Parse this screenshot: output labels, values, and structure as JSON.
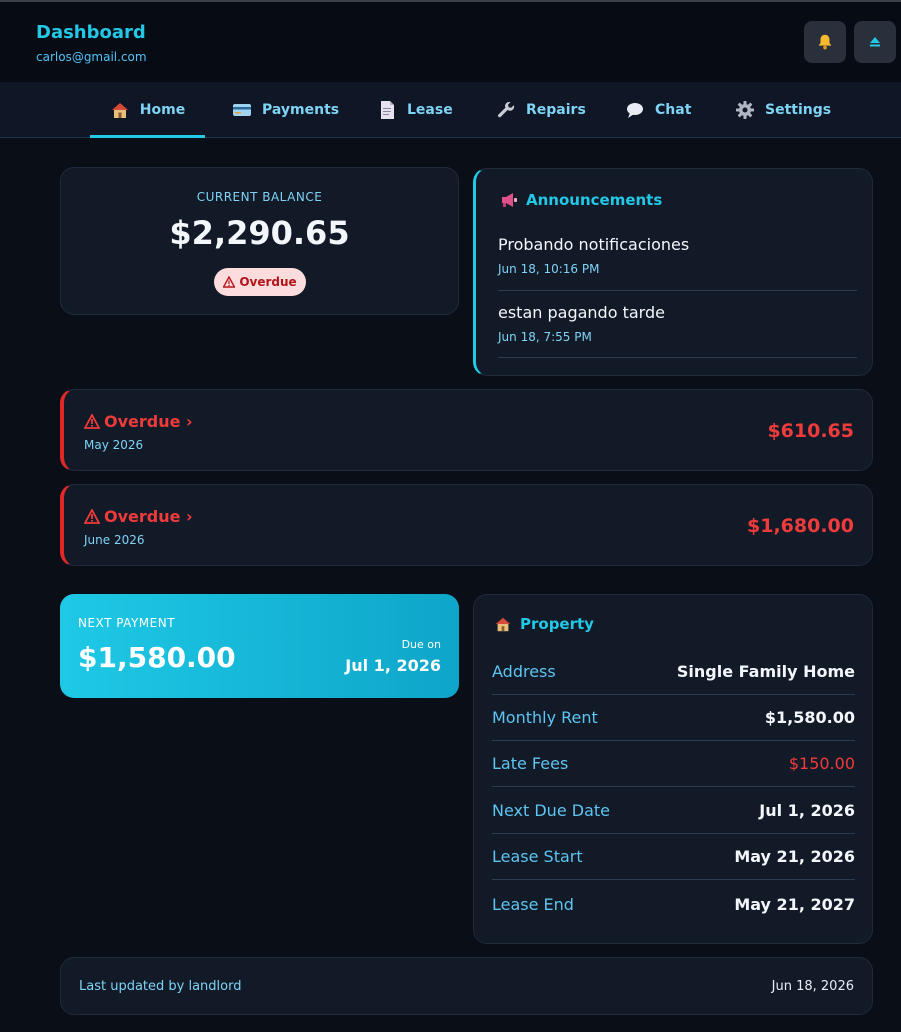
{
  "header": {
    "title": "Dashboard",
    "email": "carlos@gmail.com"
  },
  "nav": {
    "tabs": [
      {
        "label": "Home",
        "icon": "house-icon",
        "active": true
      },
      {
        "label": "Payments",
        "icon": "credit-card-icon"
      },
      {
        "label": "Lease",
        "icon": "document-icon"
      },
      {
        "label": "Repairs",
        "icon": "wrench-icon"
      },
      {
        "label": "Chat",
        "icon": "speech-bubble-icon"
      },
      {
        "label": "Settings",
        "icon": "gear-icon"
      }
    ]
  },
  "balance": {
    "label": "CURRENT BALANCE",
    "value": "$2,290.65",
    "status": "Overdue"
  },
  "announcements": {
    "title": "Announcements",
    "items": [
      {
        "text": "Probando notificaciones",
        "time": "Jun 18, 10:16 PM"
      },
      {
        "text": "estan pagando tarde",
        "time": "Jun 18, 7:55 PM"
      }
    ]
  },
  "overdue": [
    {
      "title": "Overdue ›",
      "month": "May 2026",
      "amount": "$610.65"
    },
    {
      "title": "Overdue ›",
      "month": "June 2026",
      "amount": "$1,680.00"
    }
  ],
  "next_payment": {
    "label": "NEXT PAYMENT",
    "amount": "$1,580.00",
    "due_label": "Due on",
    "due_date": "Jul 1, 2026"
  },
  "property": {
    "title": "Property",
    "rows": [
      {
        "key": "Address",
        "value": "Single Family Home"
      },
      {
        "key": "Monthly Rent",
        "value": "$1,580.00"
      },
      {
        "key": "Late Fees",
        "value": "$150.00"
      },
      {
        "key": "Next Due Date",
        "value": "Jul 1, 2026"
      },
      {
        "key": "Lease Start",
        "value": "May 21, 2026"
      },
      {
        "key": "Lease End",
        "value": "May 21, 2027"
      }
    ]
  },
  "footer": {
    "updated_by": "Last updated by landlord",
    "date": "Jun 18, 2026"
  },
  "colors": {
    "accent": "#22c8e6",
    "danger": "#ef3b3b",
    "background": "#0a0e17",
    "card": "#121a28"
  }
}
